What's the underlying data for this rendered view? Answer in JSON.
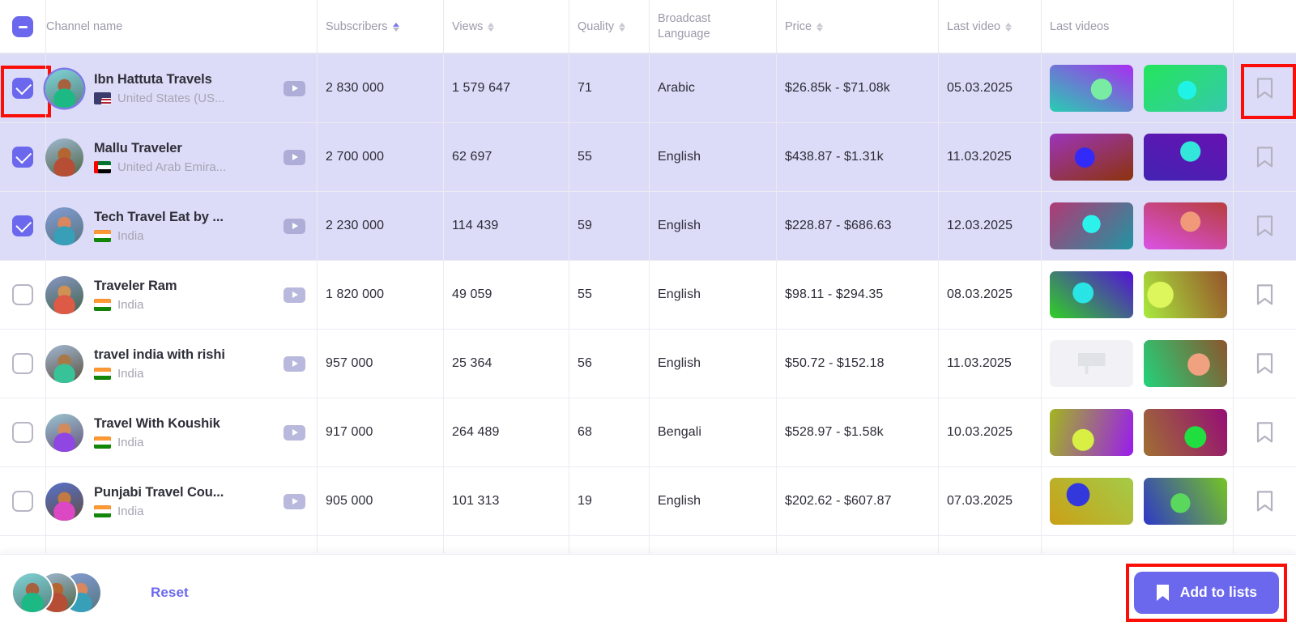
{
  "colors": {
    "accent": "#6b68ee",
    "selected_row_bg": "#dcdcf8",
    "highlight_box": "#fb0d08",
    "muted_text": "#a5a4b3"
  },
  "header": {
    "select_all_state": "indeterminate",
    "columns": [
      {
        "key": "channel_name",
        "label": "Channel name",
        "sortable": false
      },
      {
        "key": "subscribers",
        "label": "Subscribers",
        "sortable": true,
        "sort_active": true
      },
      {
        "key": "views",
        "label": "Views",
        "sortable": true,
        "sort_active": false
      },
      {
        "key": "quality",
        "label": "Quality",
        "sortable": true,
        "sort_active": false
      },
      {
        "key": "broadcast_language",
        "label": "Broadcast Language",
        "label_line1": "Broadcast",
        "label_line2": "Language",
        "sortable": false
      },
      {
        "key": "price",
        "label": "Price",
        "sortable": true,
        "sort_active": false
      },
      {
        "key": "last_video",
        "label": "Last video",
        "sortable": true,
        "sort_active": false
      },
      {
        "key": "last_videos",
        "label": "Last videos",
        "sortable": false
      }
    ]
  },
  "rows": [
    {
      "selected": true,
      "highlight_checkbox": true,
      "highlight_bookmark": true,
      "avatar_ring": true,
      "name": "Ibn Hattuta Travels",
      "country": "United States (US...",
      "flag": "us",
      "subscribers": "2 830 000",
      "views": "1 579 647",
      "quality": "71",
      "language": "Arabic",
      "price": "$26.85k - $71.08k",
      "last_video": "05.03.2025",
      "thumbs": [
        "thumb-ibn-1",
        "thumb-ibn-2"
      ]
    },
    {
      "selected": true,
      "highlight_checkbox": false,
      "highlight_bookmark": false,
      "avatar_ring": false,
      "name": "Mallu Traveler",
      "country": "United Arab Emira...",
      "flag": "ae",
      "subscribers": "2 700 000",
      "views": "62 697",
      "quality": "55",
      "language": "English",
      "price": "$438.87 - $1.31k",
      "last_video": "11.03.2025",
      "thumbs": [
        "thumb-mallu-1",
        "thumb-mallu-2"
      ]
    },
    {
      "selected": true,
      "highlight_checkbox": false,
      "highlight_bookmark": false,
      "avatar_ring": false,
      "name": "Tech Travel Eat by ...",
      "country": "India",
      "flag": "in",
      "subscribers": "2 230 000",
      "views": "114 439",
      "quality": "59",
      "language": "English",
      "price": "$228.87 - $686.63",
      "last_video": "12.03.2025",
      "thumbs": [
        "thumb-tech-1",
        "thumb-tech-2"
      ]
    },
    {
      "selected": false,
      "highlight_checkbox": false,
      "highlight_bookmark": false,
      "avatar_ring": false,
      "name": "Traveler Ram",
      "country": "India",
      "flag": "in",
      "subscribers": "1 820 000",
      "views": "49 059",
      "quality": "55",
      "language": "English",
      "price": "$98.11 - $294.35",
      "last_video": "08.03.2025",
      "thumbs": [
        "thumb-ram-1",
        "thumb-ram-2"
      ]
    },
    {
      "selected": false,
      "highlight_checkbox": false,
      "highlight_bookmark": false,
      "avatar_ring": false,
      "name": "travel india with rishi",
      "country": "India",
      "flag": "in",
      "subscribers": "957 000",
      "views": "25 364",
      "quality": "56",
      "language": "English",
      "price": "$50.72 - $152.18",
      "last_video": "11.03.2025",
      "thumbs": [
        "thumb-placeholder",
        "thumb-rishi-2"
      ]
    },
    {
      "selected": false,
      "highlight_checkbox": false,
      "highlight_bookmark": false,
      "avatar_ring": false,
      "name": "Travel With Koushik",
      "country": "India",
      "flag": "in",
      "subscribers": "917 000",
      "views": "264 489",
      "quality": "68",
      "language": "Bengali",
      "price": "$528.97 - $1.58k",
      "last_video": "10.03.2025",
      "thumbs": [
        "thumb-koushik-1",
        "thumb-koushik-2"
      ]
    },
    {
      "selected": false,
      "highlight_checkbox": false,
      "highlight_bookmark": false,
      "avatar_ring": false,
      "name": "Punjabi Travel Cou...",
      "country": "India",
      "flag": "in",
      "subscribers": "905 000",
      "views": "101 313",
      "quality": "19",
      "language": "English",
      "price": "$202.62 - $607.87",
      "last_video": "07.03.2025",
      "thumbs": [
        "thumb-punjabi-1",
        "thumb-punjabi-2"
      ]
    }
  ],
  "bottom_bar": {
    "selected_avatars": [
      "Ibn Hattuta Travels",
      "Mallu Traveler",
      "Tech Travel Eat by ..."
    ],
    "reset_label": "Reset",
    "add_to_lists_label": "Add to lists",
    "add_to_lists_icon": "bookmark-icon",
    "add_to_lists_highlighted": true
  }
}
